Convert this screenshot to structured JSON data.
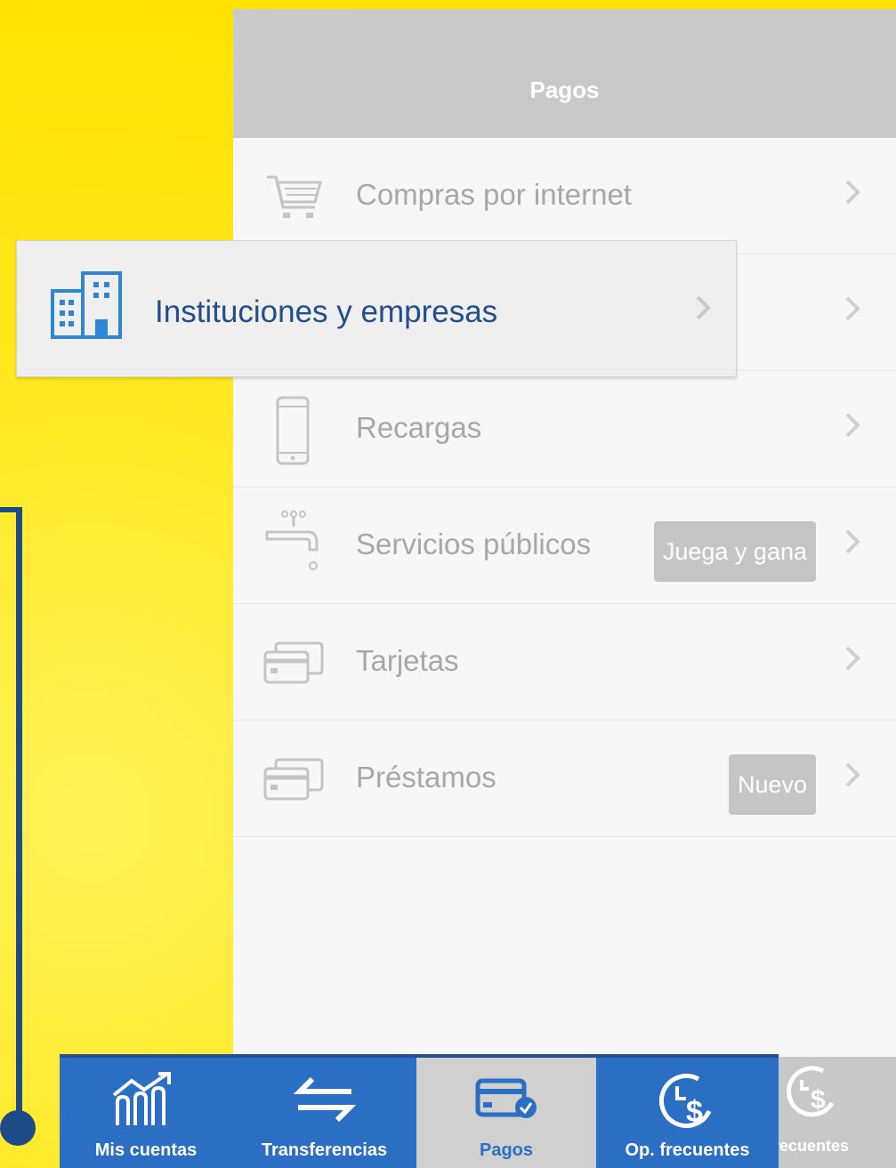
{
  "header": {
    "title": "Pagos"
  },
  "menu": {
    "items": [
      {
        "label": "Compras por internet",
        "icon": "cart-icon"
      },
      {
        "label": "",
        "icon": ""
      },
      {
        "label": "Recargas",
        "icon": "phone-icon"
      },
      {
        "label": "Servicios públicos",
        "icon": "faucet-icon",
        "badge": "Juega y gana"
      },
      {
        "label": "Tarjetas",
        "icon": "cards-icon"
      },
      {
        "label": "Préstamos",
        "icon": "cards-icon",
        "badge": "Nuevo"
      }
    ]
  },
  "highlight": {
    "label": "Instituciones y empresas",
    "icon": "building-icon"
  },
  "tabbar": {
    "tabs": [
      {
        "label": "Mis cuentas",
        "icon": "accounts-chart-icon"
      },
      {
        "label": "Transferencias",
        "icon": "transfer-arrows-icon"
      },
      {
        "label": "Pagos",
        "icon": "payment-card-check-icon",
        "active": true
      },
      {
        "label": "Op. frecuentes",
        "icon": "clock-dollar-icon"
      }
    ],
    "ghost_label": "recuentes"
  },
  "colors": {
    "accent": "#2a6fc4",
    "highlight_text": "#244d8c",
    "background": "#ffe100",
    "connector": "#1e4a85"
  }
}
